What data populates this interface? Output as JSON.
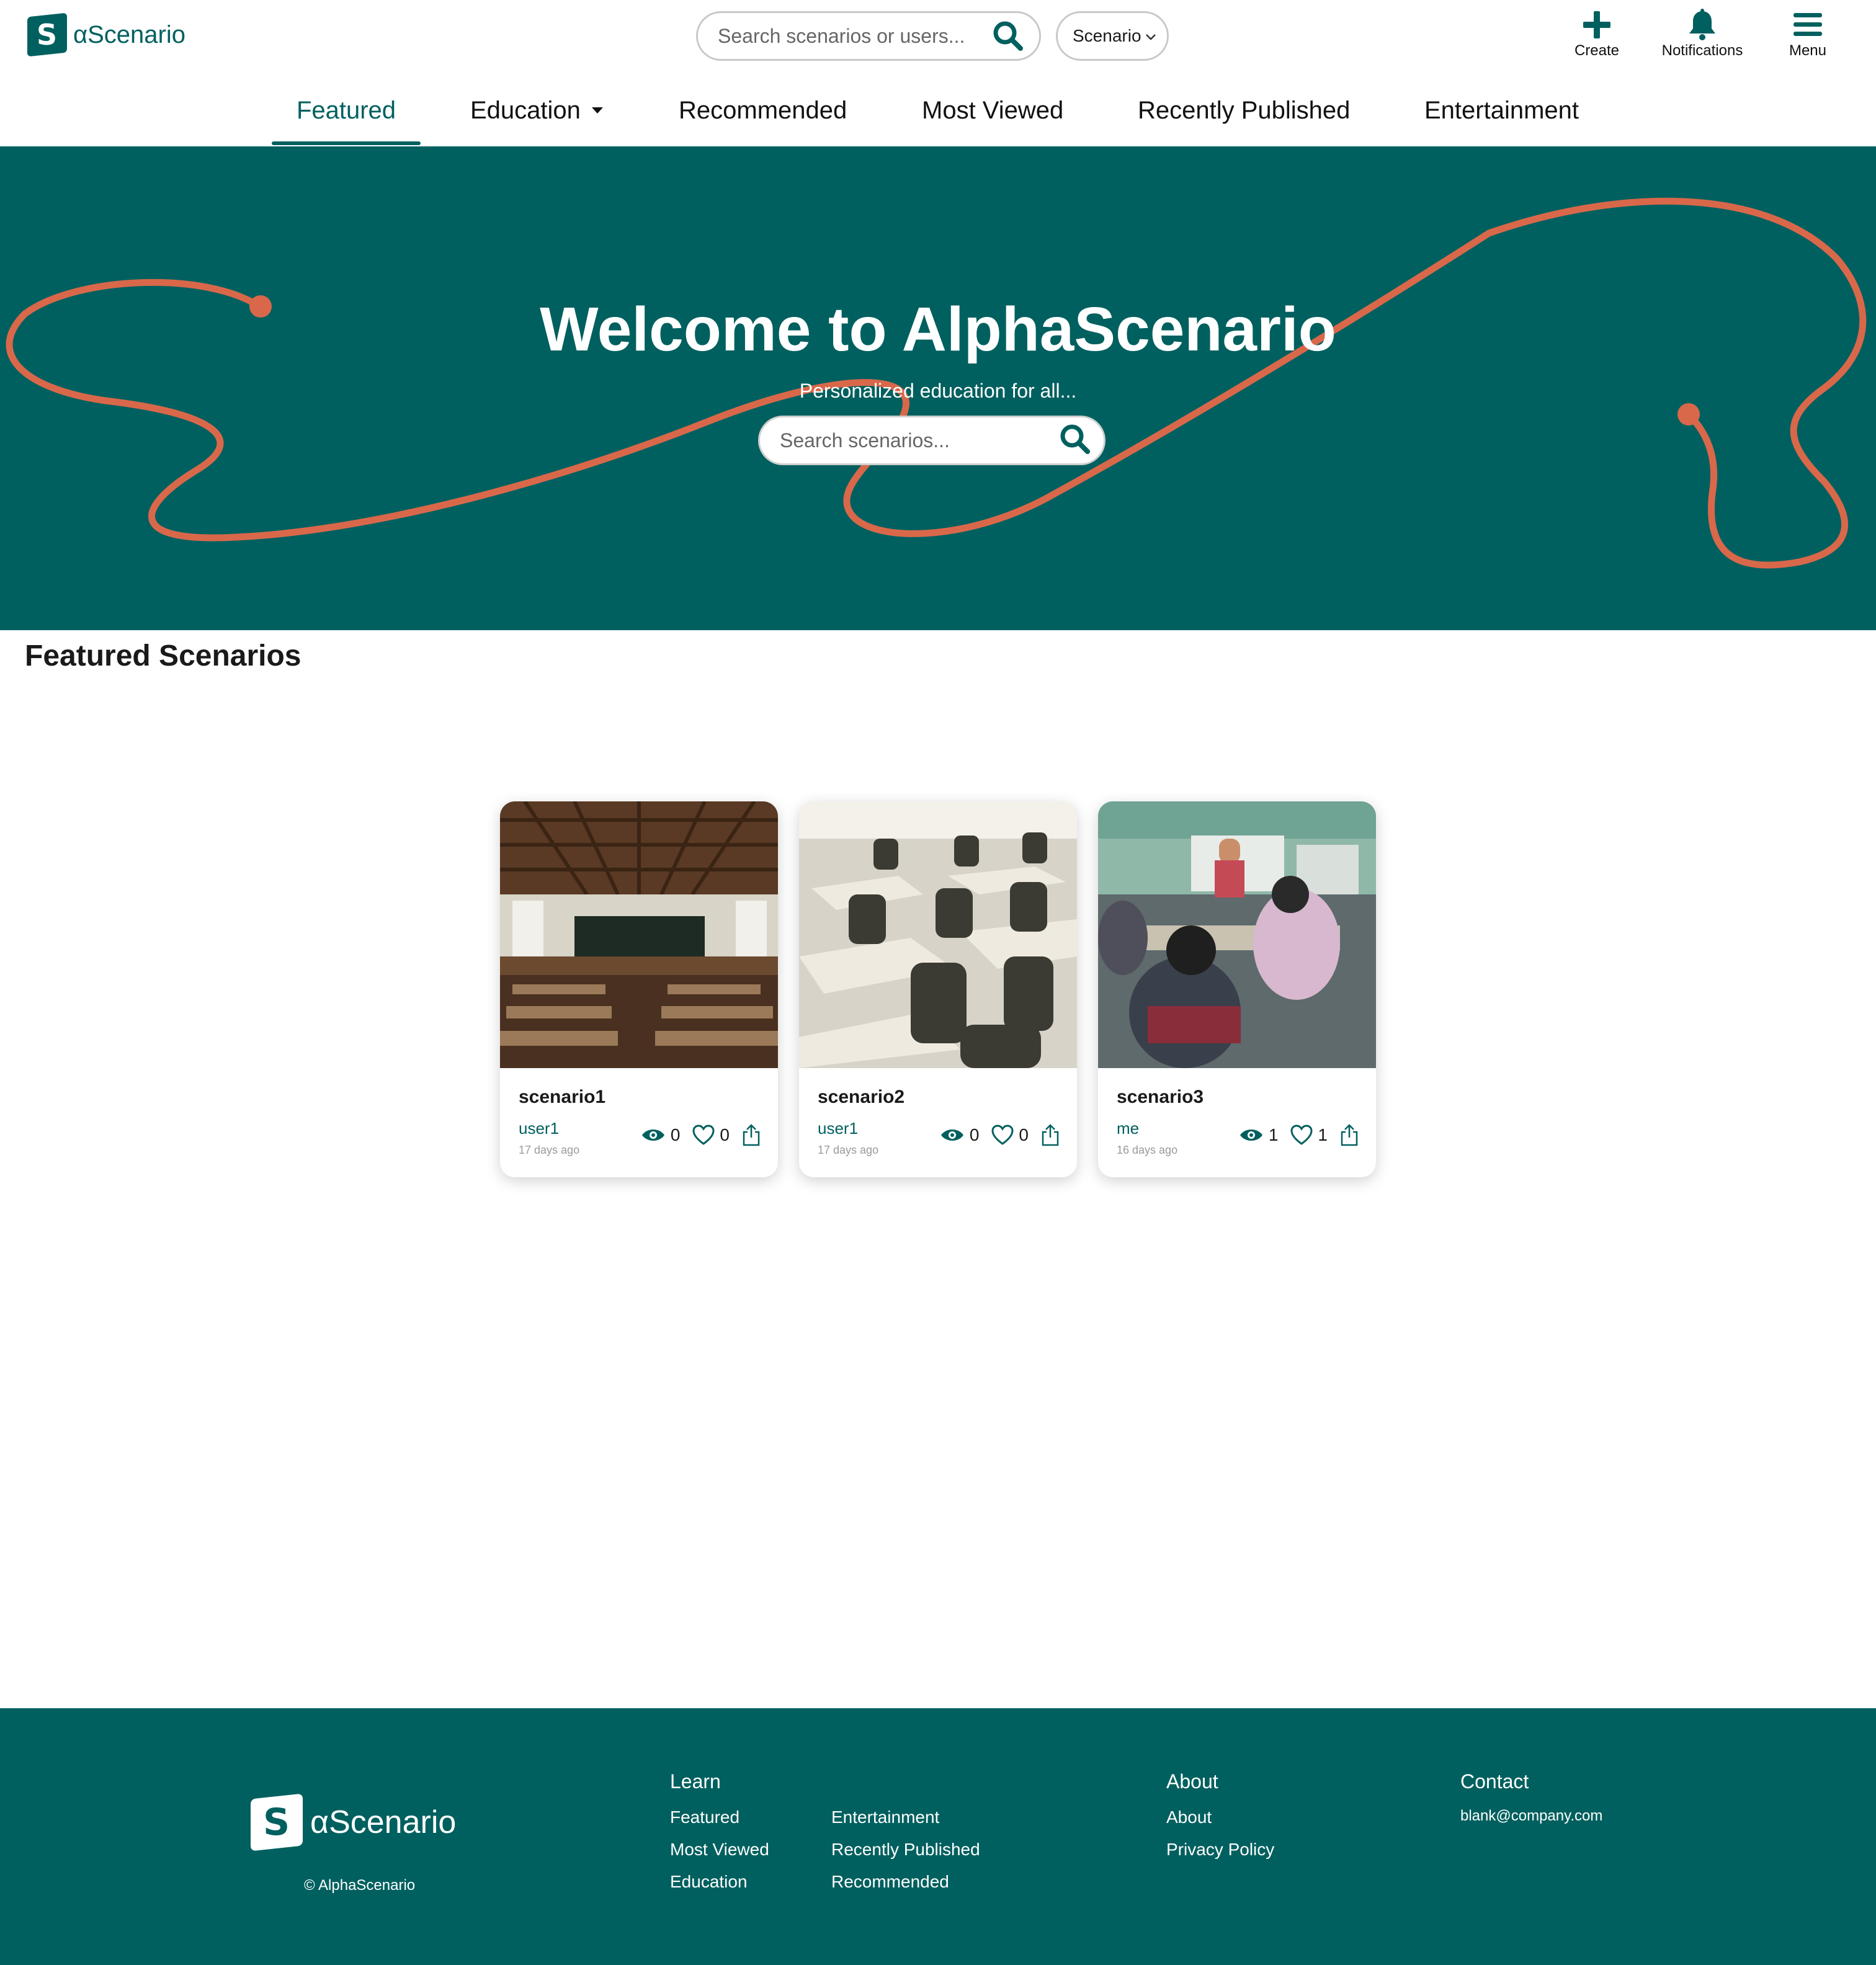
{
  "brand": {
    "name": "αScenario",
    "glyph": "S"
  },
  "header": {
    "search_placeholder": "Search scenarios or users...",
    "search_type": "Scenario",
    "actions": {
      "create": "Create",
      "notifications": "Notifications",
      "menu": "Menu"
    }
  },
  "nav": {
    "items": [
      "Featured",
      "Education",
      "Recommended",
      "Most Viewed",
      "Recently Published",
      "Entertainment"
    ],
    "active": "Featured"
  },
  "hero": {
    "title": "Welcome to AlphaScenario",
    "subtitle": "Personalized education for all...",
    "search_placeholder": "Search scenarios..."
  },
  "featured": {
    "title": "Featured Scenarios",
    "cards": [
      {
        "title": "scenario1",
        "author": "user1",
        "ago": "17 days ago",
        "views": "0",
        "likes": "0",
        "image": "classroom-wooden-desks-chalkboard"
      },
      {
        "title": "scenario2",
        "author": "user1",
        "ago": "17 days ago",
        "views": "0",
        "likes": "0",
        "image": "classroom-empty-chairs"
      },
      {
        "title": "scenario3",
        "author": "me",
        "ago": "16 days ago",
        "views": "1",
        "likes": "1",
        "image": "classroom-students-teacher"
      }
    ]
  },
  "footer": {
    "copyright": "© AlphaScenario",
    "learn": {
      "heading": "Learn",
      "links": [
        "Featured",
        "Most Viewed",
        "Education",
        "Entertainment",
        "Recently Published",
        "Recommended"
      ]
    },
    "about": {
      "heading": "About",
      "links": [
        "About",
        "Privacy Policy"
      ]
    },
    "contact": {
      "heading": "Contact",
      "email": "blank@company.com"
    }
  },
  "colors": {
    "teal": "#00605f",
    "accent_line": "#d9684a"
  }
}
